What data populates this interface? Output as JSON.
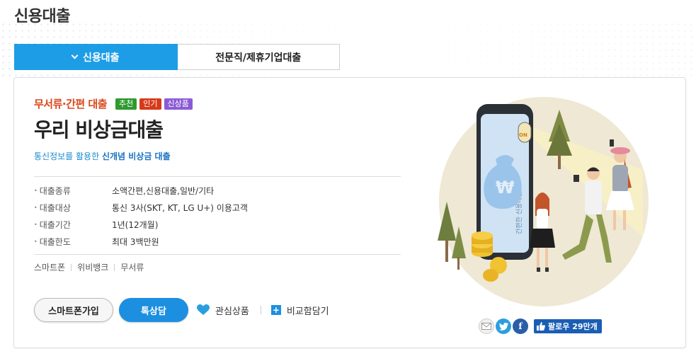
{
  "page": {
    "title": "신용대출"
  },
  "tabs": [
    {
      "label": "신용대출",
      "active": true
    },
    {
      "label": "전문직/제휴기업대출",
      "active": false
    }
  ],
  "product": {
    "category": "무서류·간편 대출",
    "badges": [
      {
        "label": "추천",
        "color": "#2e9a2e"
      },
      {
        "label": "인기",
        "color": "#d73a1a"
      },
      {
        "label": "신상품",
        "color": "#8a5bd6"
      }
    ],
    "name": "우리 비상금대출",
    "tagline_prefix": "통신정보를 활용한 ",
    "tagline_highlight": "신개념 비상금 대출",
    "info": [
      {
        "label": "대출종류",
        "value": "소액간편,신용대출,일반/기타"
      },
      {
        "label": "대출대상",
        "value": "통신 3사(SKT, KT, LG U+) 이용고객"
      },
      {
        "label": "대출기간",
        "value": "1년(12개월)"
      },
      {
        "label": "대출한도",
        "value": "최대 3백만원"
      }
    ],
    "keywords": [
      "스마트폰",
      "위비뱅크",
      "무서류"
    ]
  },
  "actions": {
    "smartphone_join": "스마트폰가입",
    "special_consult": "톡상담",
    "favorite": "관심상품",
    "compare": "비교함담기"
  },
  "illustration": {
    "phone_screen_text": "간편한 신용대출",
    "toggle_label": "ON",
    "bag_symbol": "₩"
  },
  "share": {
    "icons": [
      "mail-icon",
      "twitter-icon",
      "facebook-icon"
    ],
    "like_label": "팔로우 29만개"
  }
}
